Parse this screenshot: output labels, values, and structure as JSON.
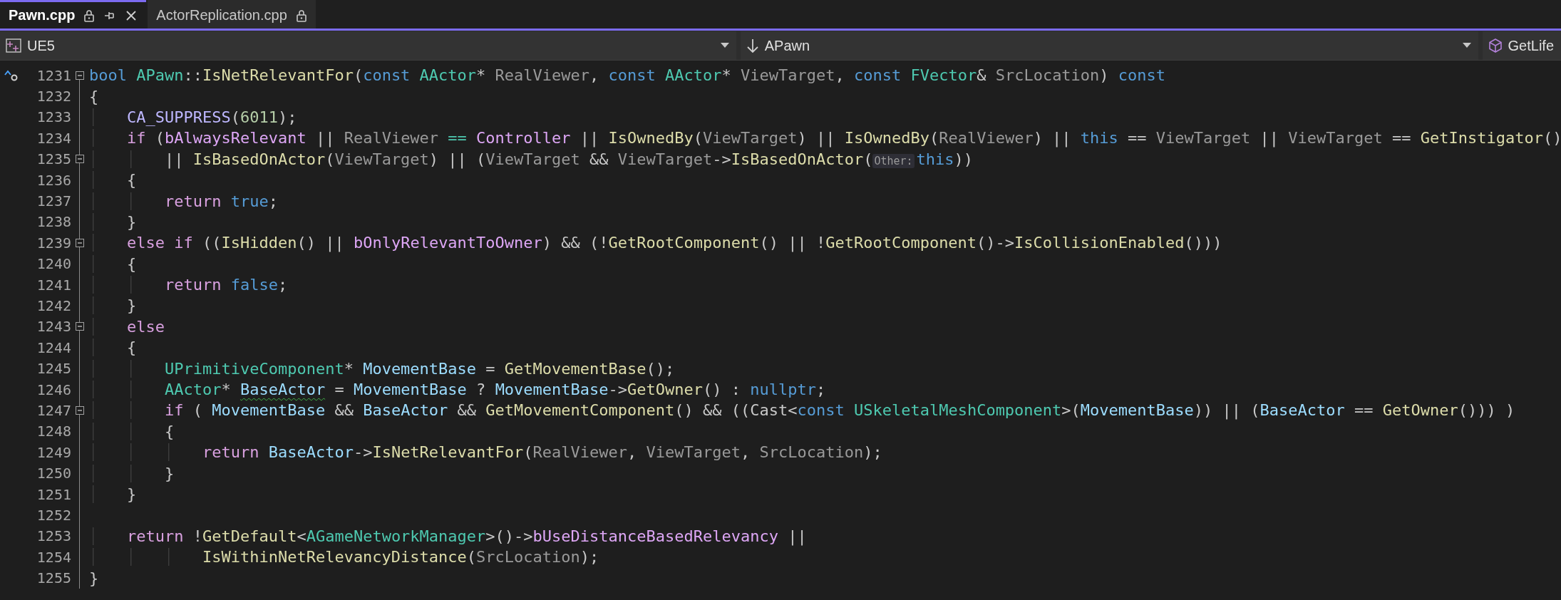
{
  "tabs": [
    {
      "title": "Pawn.cpp",
      "selected": true,
      "read_only": true
    },
    {
      "title": "ActorReplication.cpp",
      "selected": false,
      "read_only": true
    }
  ],
  "navigation_bar": [
    {
      "label": "UE5",
      "kind": "project"
    },
    {
      "label": "APawn",
      "kind": "scope"
    },
    {
      "label": "GetLife",
      "kind": "member"
    }
  ],
  "editor": {
    "lines": [
      {
        "number": "1231",
        "fold_toggle": true,
        "override_marker": true,
        "tokens": [
          {
            "text": "bool",
            "kind": "keyword"
          },
          {
            "text": " APawn",
            "kind": "type"
          },
          {
            "text": "::",
            "kind": "plain"
          },
          {
            "text": "IsNetRelevantFor",
            "kind": "function"
          },
          {
            "text": "(",
            "kind": "plain"
          },
          {
            "text": "const",
            "kind": "keyword"
          },
          {
            "text": " AActor",
            "kind": "type"
          },
          {
            "text": "* ",
            "kind": "plain"
          },
          {
            "text": "RealViewer",
            "kind": "parameter"
          },
          {
            "text": ", ",
            "kind": "plain"
          },
          {
            "text": "const",
            "kind": "keyword"
          },
          {
            "text": " AActor",
            "kind": "type"
          },
          {
            "text": "* ",
            "kind": "plain"
          },
          {
            "text": "ViewTarget",
            "kind": "parameter"
          },
          {
            "text": ", ",
            "kind": "plain"
          },
          {
            "text": "const",
            "kind": "keyword"
          },
          {
            "text": " FVector",
            "kind": "type"
          },
          {
            "text": "& ",
            "kind": "plain"
          },
          {
            "text": "SrcLocation",
            "kind": "parameter"
          },
          {
            "text": ") ",
            "kind": "plain"
          },
          {
            "text": "const",
            "kind": "keyword"
          }
        ]
      },
      {
        "number": "1232",
        "fold_toggle": false,
        "override_marker": false,
        "tokens": [
          {
            "text": "{",
            "kind": "plain"
          }
        ]
      },
      {
        "number": "1233",
        "fold_toggle": false,
        "override_marker": false,
        "tokens": [
          {
            "text": "    CA_SUPPRESS",
            "kind": "macro"
          },
          {
            "text": "(",
            "kind": "plain"
          },
          {
            "text": "6011",
            "kind": "number"
          },
          {
            "text": ");",
            "kind": "plain"
          }
        ]
      },
      {
        "number": "1234",
        "fold_toggle": false,
        "override_marker": false,
        "tokens": [
          {
            "text": "    if",
            "kind": "control"
          },
          {
            "text": " (",
            "kind": "plain"
          },
          {
            "text": "bAlwaysRelevant",
            "kind": "member"
          },
          {
            "text": " || ",
            "kind": "plain"
          },
          {
            "text": "RealViewer",
            "kind": "parameter"
          },
          {
            "text": " ==",
            "kind": "operator"
          },
          {
            "text": " Controller",
            "kind": "member"
          },
          {
            "text": " || ",
            "kind": "plain"
          },
          {
            "text": "IsOwnedBy",
            "kind": "function"
          },
          {
            "text": "(",
            "kind": "plain"
          },
          {
            "text": "ViewTarget",
            "kind": "parameter"
          },
          {
            "text": ") || ",
            "kind": "plain"
          },
          {
            "text": "IsOwnedBy",
            "kind": "function"
          },
          {
            "text": "(",
            "kind": "plain"
          },
          {
            "text": "RealViewer",
            "kind": "parameter"
          },
          {
            "text": ") || ",
            "kind": "plain"
          },
          {
            "text": "this",
            "kind": "keyword"
          },
          {
            "text": " == ",
            "kind": "plain"
          },
          {
            "text": "ViewTarget",
            "kind": "parameter"
          },
          {
            "text": " || ",
            "kind": "plain"
          },
          {
            "text": "ViewTarget",
            "kind": "parameter"
          },
          {
            "text": " == ",
            "kind": "plain"
          },
          {
            "text": "GetInstigator",
            "kind": "function"
          },
          {
            "text": "()",
            "kind": "plain"
          }
        ]
      },
      {
        "number": "1235",
        "fold_toggle": true,
        "override_marker": false,
        "tokens": [
          {
            "text": "        || ",
            "kind": "plain"
          },
          {
            "text": "IsBasedOnActor",
            "kind": "function"
          },
          {
            "text": "(",
            "kind": "plain"
          },
          {
            "text": "ViewTarget",
            "kind": "parameter"
          },
          {
            "text": ") || (",
            "kind": "plain"
          },
          {
            "text": "ViewTarget",
            "kind": "parameter"
          },
          {
            "text": " && ",
            "kind": "plain"
          },
          {
            "text": "ViewTarget",
            "kind": "parameter"
          },
          {
            "text": "->",
            "kind": "plain"
          },
          {
            "text": "IsBasedOnActor",
            "kind": "function"
          },
          {
            "text": "(",
            "kind": "plain"
          },
          {
            "text": "Other:",
            "kind": "hint"
          },
          {
            "text": "this",
            "kind": "keyword"
          },
          {
            "text": "))",
            "kind": "plain"
          }
        ]
      },
      {
        "number": "1236",
        "fold_toggle": false,
        "override_marker": false,
        "tokens": [
          {
            "text": "    {",
            "kind": "plain"
          }
        ]
      },
      {
        "number": "1237",
        "fold_toggle": false,
        "override_marker": false,
        "tokens": [
          {
            "text": "        return",
            "kind": "control"
          },
          {
            "text": " true",
            "kind": "keyword"
          },
          {
            "text": ";",
            "kind": "plain"
          }
        ]
      },
      {
        "number": "1238",
        "fold_toggle": false,
        "override_marker": false,
        "tokens": [
          {
            "text": "    }",
            "kind": "plain"
          }
        ]
      },
      {
        "number": "1239",
        "fold_toggle": true,
        "override_marker": false,
        "tokens": [
          {
            "text": "    else",
            "kind": "control"
          },
          {
            "text": " if",
            "kind": "control"
          },
          {
            "text": " ((",
            "kind": "plain"
          },
          {
            "text": "IsHidden",
            "kind": "function"
          },
          {
            "text": "() || ",
            "kind": "plain"
          },
          {
            "text": "bOnlyRelevantToOwner",
            "kind": "member"
          },
          {
            "text": ") && (!",
            "kind": "plain"
          },
          {
            "text": "GetRootComponent",
            "kind": "function"
          },
          {
            "text": "() || !",
            "kind": "plain"
          },
          {
            "text": "GetRootComponent",
            "kind": "function"
          },
          {
            "text": "()->",
            "kind": "plain"
          },
          {
            "text": "IsCollisionEnabled",
            "kind": "function"
          },
          {
            "text": "()))",
            "kind": "plain"
          }
        ]
      },
      {
        "number": "1240",
        "fold_toggle": false,
        "override_marker": false,
        "tokens": [
          {
            "text": "    {",
            "kind": "plain"
          }
        ]
      },
      {
        "number": "1241",
        "fold_toggle": false,
        "override_marker": false,
        "tokens": [
          {
            "text": "        return",
            "kind": "control"
          },
          {
            "text": " false",
            "kind": "keyword"
          },
          {
            "text": ";",
            "kind": "plain"
          }
        ]
      },
      {
        "number": "1242",
        "fold_toggle": false,
        "override_marker": false,
        "tokens": [
          {
            "text": "    }",
            "kind": "plain"
          }
        ]
      },
      {
        "number": "1243",
        "fold_toggle": true,
        "override_marker": false,
        "tokens": [
          {
            "text": "    else",
            "kind": "control"
          }
        ]
      },
      {
        "number": "1244",
        "fold_toggle": false,
        "override_marker": false,
        "tokens": [
          {
            "text": "    {",
            "kind": "plain"
          }
        ]
      },
      {
        "number": "1245",
        "fold_toggle": false,
        "override_marker": false,
        "tokens": [
          {
            "text": "        UPrimitiveComponent",
            "kind": "type"
          },
          {
            "text": "* ",
            "kind": "plain"
          },
          {
            "text": "MovementBase",
            "kind": "local"
          },
          {
            "text": " = ",
            "kind": "plain"
          },
          {
            "text": "GetMovementBase",
            "kind": "function"
          },
          {
            "text": "();",
            "kind": "plain"
          }
        ]
      },
      {
        "number": "1246",
        "fold_toggle": false,
        "override_marker": false,
        "tokens": [
          {
            "text": "        AActor",
            "kind": "type"
          },
          {
            "text": "* ",
            "kind": "plain"
          },
          {
            "text": "BaseActor",
            "kind": "local_warning"
          },
          {
            "text": " = ",
            "kind": "plain"
          },
          {
            "text": "MovementBase",
            "kind": "local"
          },
          {
            "text": " ? ",
            "kind": "plain"
          },
          {
            "text": "MovementBase",
            "kind": "local"
          },
          {
            "text": "->",
            "kind": "plain"
          },
          {
            "text": "GetOwner",
            "kind": "function"
          },
          {
            "text": "() : ",
            "kind": "plain"
          },
          {
            "text": "nullptr",
            "kind": "keyword"
          },
          {
            "text": ";",
            "kind": "plain"
          }
        ]
      },
      {
        "number": "1247",
        "fold_toggle": true,
        "override_marker": false,
        "tokens": [
          {
            "text": "        if",
            "kind": "control"
          },
          {
            "text": " ( ",
            "kind": "plain"
          },
          {
            "text": "MovementBase",
            "kind": "local"
          },
          {
            "text": " && ",
            "kind": "plain"
          },
          {
            "text": "BaseActor",
            "kind": "local"
          },
          {
            "text": " && ",
            "kind": "plain"
          },
          {
            "text": "GetMovementComponent",
            "kind": "function"
          },
          {
            "text": "() && ((",
            "kind": "plain"
          },
          {
            "text": "Cast",
            "kind": "plain"
          },
          {
            "text": "<",
            "kind": "plain"
          },
          {
            "text": "const",
            "kind": "keyword"
          },
          {
            "text": " USkeletalMeshComponent",
            "kind": "type"
          },
          {
            "text": ">(",
            "kind": "plain"
          },
          {
            "text": "MovementBase",
            "kind": "local"
          },
          {
            "text": ")) || (",
            "kind": "plain"
          },
          {
            "text": "BaseActor",
            "kind": "local"
          },
          {
            "text": " == ",
            "kind": "plain"
          },
          {
            "text": "GetOwner",
            "kind": "function"
          },
          {
            "text": "())) )",
            "kind": "plain"
          }
        ]
      },
      {
        "number": "1248",
        "fold_toggle": false,
        "override_marker": false,
        "tokens": [
          {
            "text": "        {",
            "kind": "plain"
          }
        ]
      },
      {
        "number": "1249",
        "fold_toggle": false,
        "override_marker": false,
        "tokens": [
          {
            "text": "            return",
            "kind": "control"
          },
          {
            "text": " BaseActor",
            "kind": "local"
          },
          {
            "text": "->",
            "kind": "plain"
          },
          {
            "text": "IsNetRelevantFor",
            "kind": "function"
          },
          {
            "text": "(",
            "kind": "plain"
          },
          {
            "text": "RealViewer",
            "kind": "parameter"
          },
          {
            "text": ", ",
            "kind": "plain"
          },
          {
            "text": "ViewTarget",
            "kind": "parameter"
          },
          {
            "text": ", ",
            "kind": "plain"
          },
          {
            "text": "SrcLocation",
            "kind": "parameter"
          },
          {
            "text": ");",
            "kind": "plain"
          }
        ]
      },
      {
        "number": "1250",
        "fold_toggle": false,
        "override_marker": false,
        "tokens": [
          {
            "text": "        }",
            "kind": "plain"
          }
        ]
      },
      {
        "number": "1251",
        "fold_toggle": false,
        "override_marker": false,
        "tokens": [
          {
            "text": "    }",
            "kind": "plain"
          }
        ]
      },
      {
        "number": "1252",
        "fold_toggle": false,
        "override_marker": false
      },
      {
        "number": "1253",
        "fold_toggle": false,
        "override_marker": false,
        "tokens": [
          {
            "text": "    return",
            "kind": "control"
          },
          {
            "text": " !",
            "kind": "plain"
          },
          {
            "text": "GetDefault",
            "kind": "function"
          },
          {
            "text": "<",
            "kind": "plain"
          },
          {
            "text": "AGameNetworkManager",
            "kind": "type"
          },
          {
            "text": ">()->",
            "kind": "plain"
          },
          {
            "text": "bUseDistanceBasedRelevancy",
            "kind": "member"
          },
          {
            "text": " ||",
            "kind": "plain"
          }
        ]
      },
      {
        "number": "1254",
        "fold_toggle": false,
        "override_marker": false,
        "tokens": [
          {
            "text": "            IsWithinNetRelevancyDistance",
            "kind": "function"
          },
          {
            "text": "(",
            "kind": "plain"
          },
          {
            "text": "SrcLocation",
            "kind": "parameter"
          },
          {
            "text": ");",
            "kind": "plain"
          }
        ]
      },
      {
        "number": "1255",
        "fold_toggle": false,
        "override_marker": false,
        "tokens": [
          {
            "text": "}",
            "kind": "plain"
          }
        ]
      }
    ]
  }
}
